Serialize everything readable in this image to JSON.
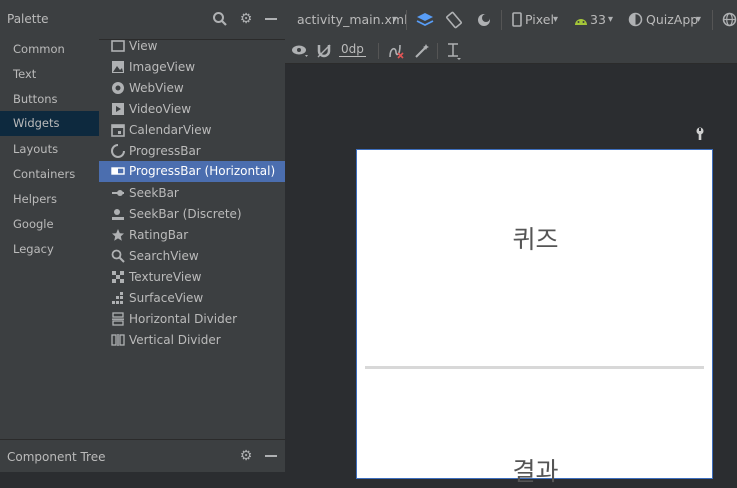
{
  "palette": {
    "title": "Palette",
    "categories": [
      {
        "label": "Common"
      },
      {
        "label": "Text"
      },
      {
        "label": "Buttons"
      },
      {
        "label": "Widgets"
      },
      {
        "label": "Layouts"
      },
      {
        "label": "Containers"
      },
      {
        "label": "Helpers"
      },
      {
        "label": "Google"
      },
      {
        "label": "Legacy"
      }
    ],
    "selected_category": "Widgets",
    "widgets": [
      {
        "label": "View",
        "icon": "view-icon"
      },
      {
        "label": "ImageView",
        "icon": "imageview-icon"
      },
      {
        "label": "WebView",
        "icon": "webview-icon"
      },
      {
        "label": "VideoView",
        "icon": "videoview-icon"
      },
      {
        "label": "CalendarView",
        "icon": "calendar-icon"
      },
      {
        "label": "ProgressBar",
        "icon": "progressbar-icon"
      },
      {
        "label": "ProgressBar (Horizontal)",
        "icon": "progressbar-horizontal-icon"
      },
      {
        "label": "SeekBar",
        "icon": "seekbar-icon"
      },
      {
        "label": "SeekBar (Discrete)",
        "icon": "seekbar-discrete-icon"
      },
      {
        "label": "RatingBar",
        "icon": "star-icon"
      },
      {
        "label": "SearchView",
        "icon": "search-icon"
      },
      {
        "label": "TextureView",
        "icon": "textureview-icon"
      },
      {
        "label": "SurfaceView",
        "icon": "surfaceview-icon"
      },
      {
        "label": "Horizontal Divider",
        "icon": "horizontal-divider-icon"
      },
      {
        "label": "Vertical Divider",
        "icon": "vertical-divider-icon"
      }
    ],
    "selected_widget": "ProgressBar (Horizontal)"
  },
  "component_tree": {
    "title": "Component Tree"
  },
  "toolbar": {
    "file_name": "activity_main.xml",
    "device": "Pixel",
    "api_level": "33",
    "app_theme": "QuizApp",
    "margin_value": "0dp"
  },
  "preview": {
    "quiz_title": "퀴즈",
    "result_label": "결과"
  },
  "colors": {
    "accent": "#4b6eaf",
    "panel": "#3c3f41",
    "canvas": "#2b2d30",
    "selected_category": "#0d293e",
    "android_green": "#a4c639"
  }
}
